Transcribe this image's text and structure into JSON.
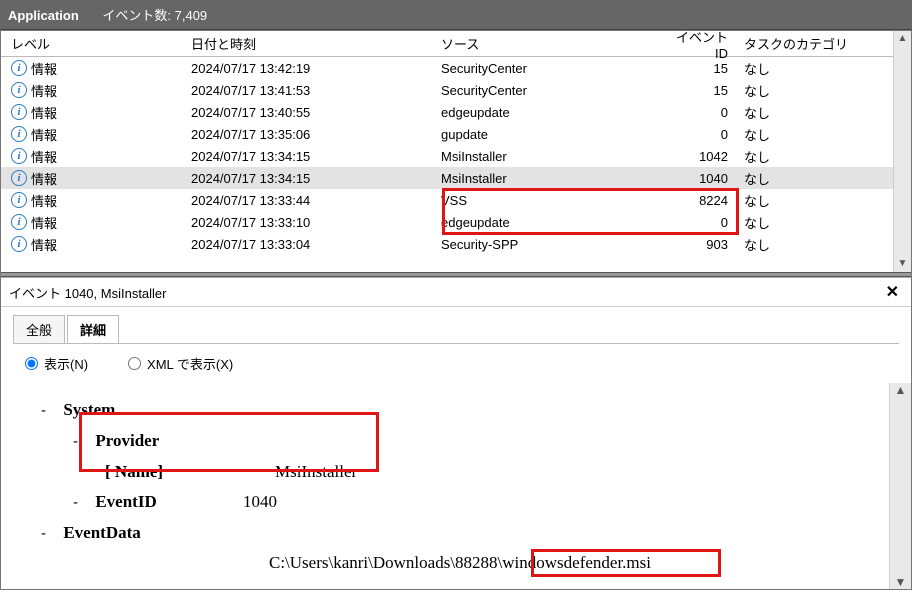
{
  "title": {
    "app": "Application",
    "count_label": "イベント数: 7,409"
  },
  "columns": {
    "level": "レベル",
    "date": "日付と時刻",
    "source": "ソース",
    "event_id": "イベント ID",
    "task": "タスクのカテゴリ"
  },
  "level_info": "情報",
  "rows": [
    {
      "date": "2024/07/17 13:42:19",
      "src": "SecurityCenter",
      "eid": "15",
      "task": "なし",
      "sel": false
    },
    {
      "date": "2024/07/17 13:41:53",
      "src": "SecurityCenter",
      "eid": "15",
      "task": "なし",
      "sel": false
    },
    {
      "date": "2024/07/17 13:40:55",
      "src": "edgeupdate",
      "eid": "0",
      "task": "なし",
      "sel": false
    },
    {
      "date": "2024/07/17 13:35:06",
      "src": "gupdate",
      "eid": "0",
      "task": "なし",
      "sel": false
    },
    {
      "date": "2024/07/17 13:34:15",
      "src": "MsiInstaller",
      "eid": "1042",
      "task": "なし",
      "sel": false
    },
    {
      "date": "2024/07/17 13:34:15",
      "src": "MsiInstaller",
      "eid": "1040",
      "task": "なし",
      "sel": true
    },
    {
      "date": "2024/07/17 13:33:44",
      "src": "VSS",
      "eid": "8224",
      "task": "なし",
      "sel": false
    },
    {
      "date": "2024/07/17 13:33:10",
      "src": "edgeupdate",
      "eid": "0",
      "task": "なし",
      "sel": false
    },
    {
      "date": "2024/07/17 13:33:04",
      "src": "Security-SPP",
      "eid": "903",
      "task": "なし",
      "sel": false
    }
  ],
  "detail": {
    "header": "イベント 1040, MsiInstaller",
    "tabs": {
      "general": "全般",
      "detail": "詳細"
    },
    "radios": {
      "show": "表示(N)",
      "xml": "XML で表示(X)"
    },
    "system_label": "System",
    "provider_label": "Provider",
    "name_label": "[ Name]",
    "name_value": "MsiInstaller",
    "eventid_label": "EventID",
    "eventid_value": "1040",
    "eventdata_label": "EventData",
    "path_prefix": "C:\\Users\\kanri\\Downloads\\88288\\",
    "path_file": "windowsdefender.msi"
  }
}
